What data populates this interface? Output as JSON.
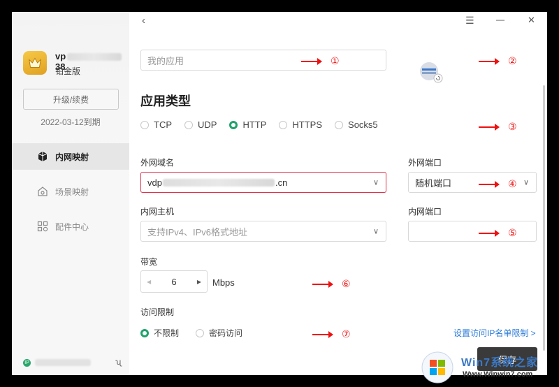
{
  "user": {
    "name": "vp",
    "name_suffix": "38",
    "tier": "铂金版",
    "upgrade_label": "升级/续费",
    "expire": "2022-03-12到期"
  },
  "nav": [
    {
      "label": "内网映射",
      "icon": "cube-icon",
      "active": true
    },
    {
      "label": "场景映射",
      "icon": "scene-icon",
      "active": false
    },
    {
      "label": "配件中心",
      "icon": "grid-icon",
      "active": false
    }
  ],
  "topbar": {
    "back": "‹",
    "menu": "☰",
    "minimize": "—",
    "close": "✕"
  },
  "app_name": {
    "placeholder": "我的应用",
    "value": ""
  },
  "section_title": "应用类型",
  "app_types": [
    {
      "label": "TCP",
      "checked": false
    },
    {
      "label": "UDP",
      "checked": false
    },
    {
      "label": "HTTP",
      "checked": true
    },
    {
      "label": "HTTPS",
      "checked": false
    },
    {
      "label": "Socks5",
      "checked": false
    }
  ],
  "external_domain": {
    "label": "外网域名",
    "prefix": "vdp",
    "suffix": ".cn"
  },
  "external_port": {
    "label": "外网端口",
    "value": "随机端口"
  },
  "internal_host": {
    "label": "内网主机",
    "placeholder": "支持IPv4、IPv6格式地址"
  },
  "internal_port": {
    "label": "内网端口",
    "value": ""
  },
  "bandwidth": {
    "label": "带宽",
    "value": "6",
    "unit": "Mbps"
  },
  "access": {
    "label": "访问限制",
    "options": [
      {
        "label": "不限制",
        "checked": true
      },
      {
        "label": "密码访问",
        "checked": false
      }
    ],
    "ip_link": "设置访问IP名单限制 >"
  },
  "save_label": "保存",
  "annotations": [
    "①",
    "②",
    "③",
    "④",
    "⑤",
    "⑥",
    "⑦"
  ],
  "watermark": {
    "text": "Win7系统之家",
    "url": "Www.Winwin7.com"
  },
  "colors": {
    "accent": "#1fa36a",
    "error": "#e0304a",
    "link": "#2b7bd8",
    "annotation": "#e11111"
  }
}
